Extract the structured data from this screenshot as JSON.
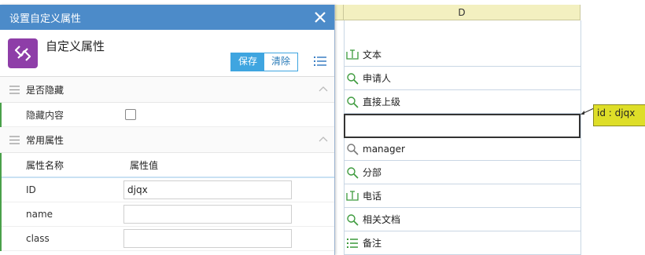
{
  "sheet": {
    "column_d": "D",
    "cells": [
      {
        "icon": "text-field-icon",
        "text": "文本"
      },
      {
        "icon": "search-icon",
        "text": "申请人"
      },
      {
        "icon": "search-icon",
        "text": "直接上级"
      },
      {
        "icon": "",
        "text": ""
      },
      {
        "icon": "search-icon",
        "text": "manager"
      },
      {
        "icon": "search-icon",
        "text": "分部"
      },
      {
        "icon": "text-field-icon",
        "text": "电话"
      },
      {
        "icon": "search-icon",
        "text": "相关文档"
      },
      {
        "icon": "list-icon",
        "text": "备注"
      }
    ],
    "comment": "id : djqx"
  },
  "dialog": {
    "title": "设置自定义属性",
    "head_title": "自定义属性",
    "save_label": "保存",
    "clear_label": "清除",
    "section_hidden": "是否隐藏",
    "hidden_content_label": "隐藏内容",
    "hidden_checked": false,
    "section_common": "常用属性",
    "col_name": "属性名称",
    "col_value": "属性值",
    "props": [
      {
        "label": "ID",
        "value": ""
      },
      {
        "label": "name",
        "value": ""
      },
      {
        "label": "class",
        "value": ""
      }
    ],
    "id_value": "djqx"
  },
  "colors": {
    "titlebar": "#4c8bc9",
    "accent": "#3fa5e0",
    "logo": "#8e3ea8",
    "comment": "#dede28",
    "header": "#f3f0c0"
  }
}
